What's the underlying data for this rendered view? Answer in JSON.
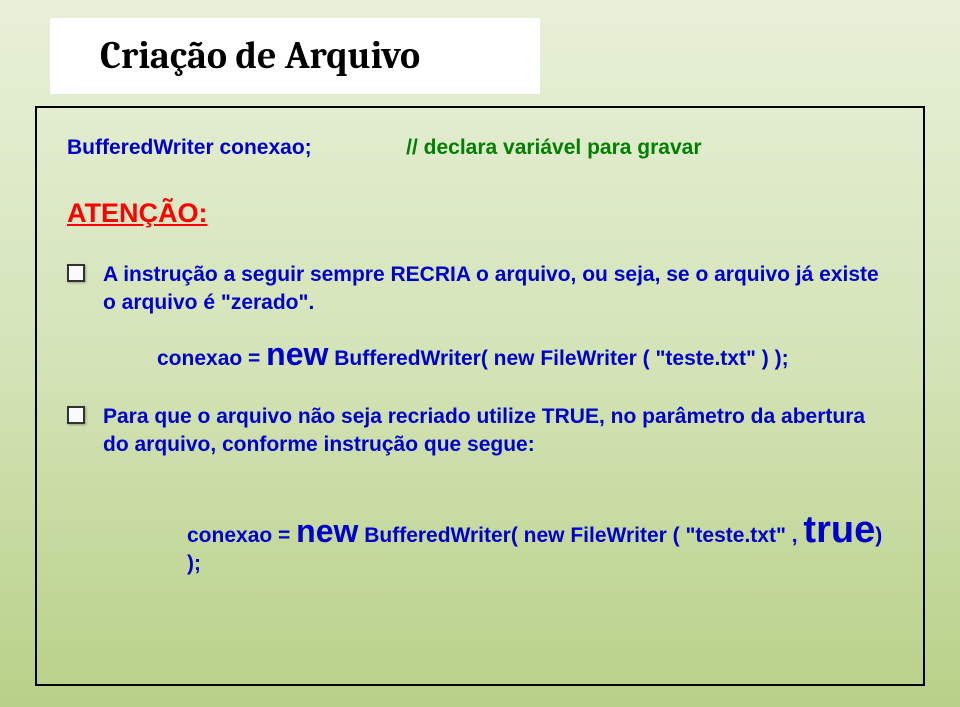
{
  "title": "Criação de Arquivo",
  "line1": {
    "code": "BufferedWriter   conexao;",
    "comment": "// declara variável para gravar"
  },
  "attention": "ATENÇÃO:",
  "bullet1": "A instrução a seguir sempre RECRIA o arquivo, ou seja, se o arquivo já existe o arquivo é \"zerado\".",
  "snippet1": {
    "prefix": "conexao = ",
    "newkw": "new",
    "suffix": " BufferedWriter( new FileWriter ( \"teste.txt\" ) );"
  },
  "bullet2": "Para que o arquivo não seja recriado utilize  TRUE,  no parâmetro da abertura do arquivo, conforme instrução que segue:",
  "snippet2": {
    "prefix": "conexao = ",
    "newkw": "new",
    "mid": " BufferedWriter( new FileWriter ( \"teste.txt\" , ",
    "truekw": "true",
    "suffix": ") );"
  }
}
